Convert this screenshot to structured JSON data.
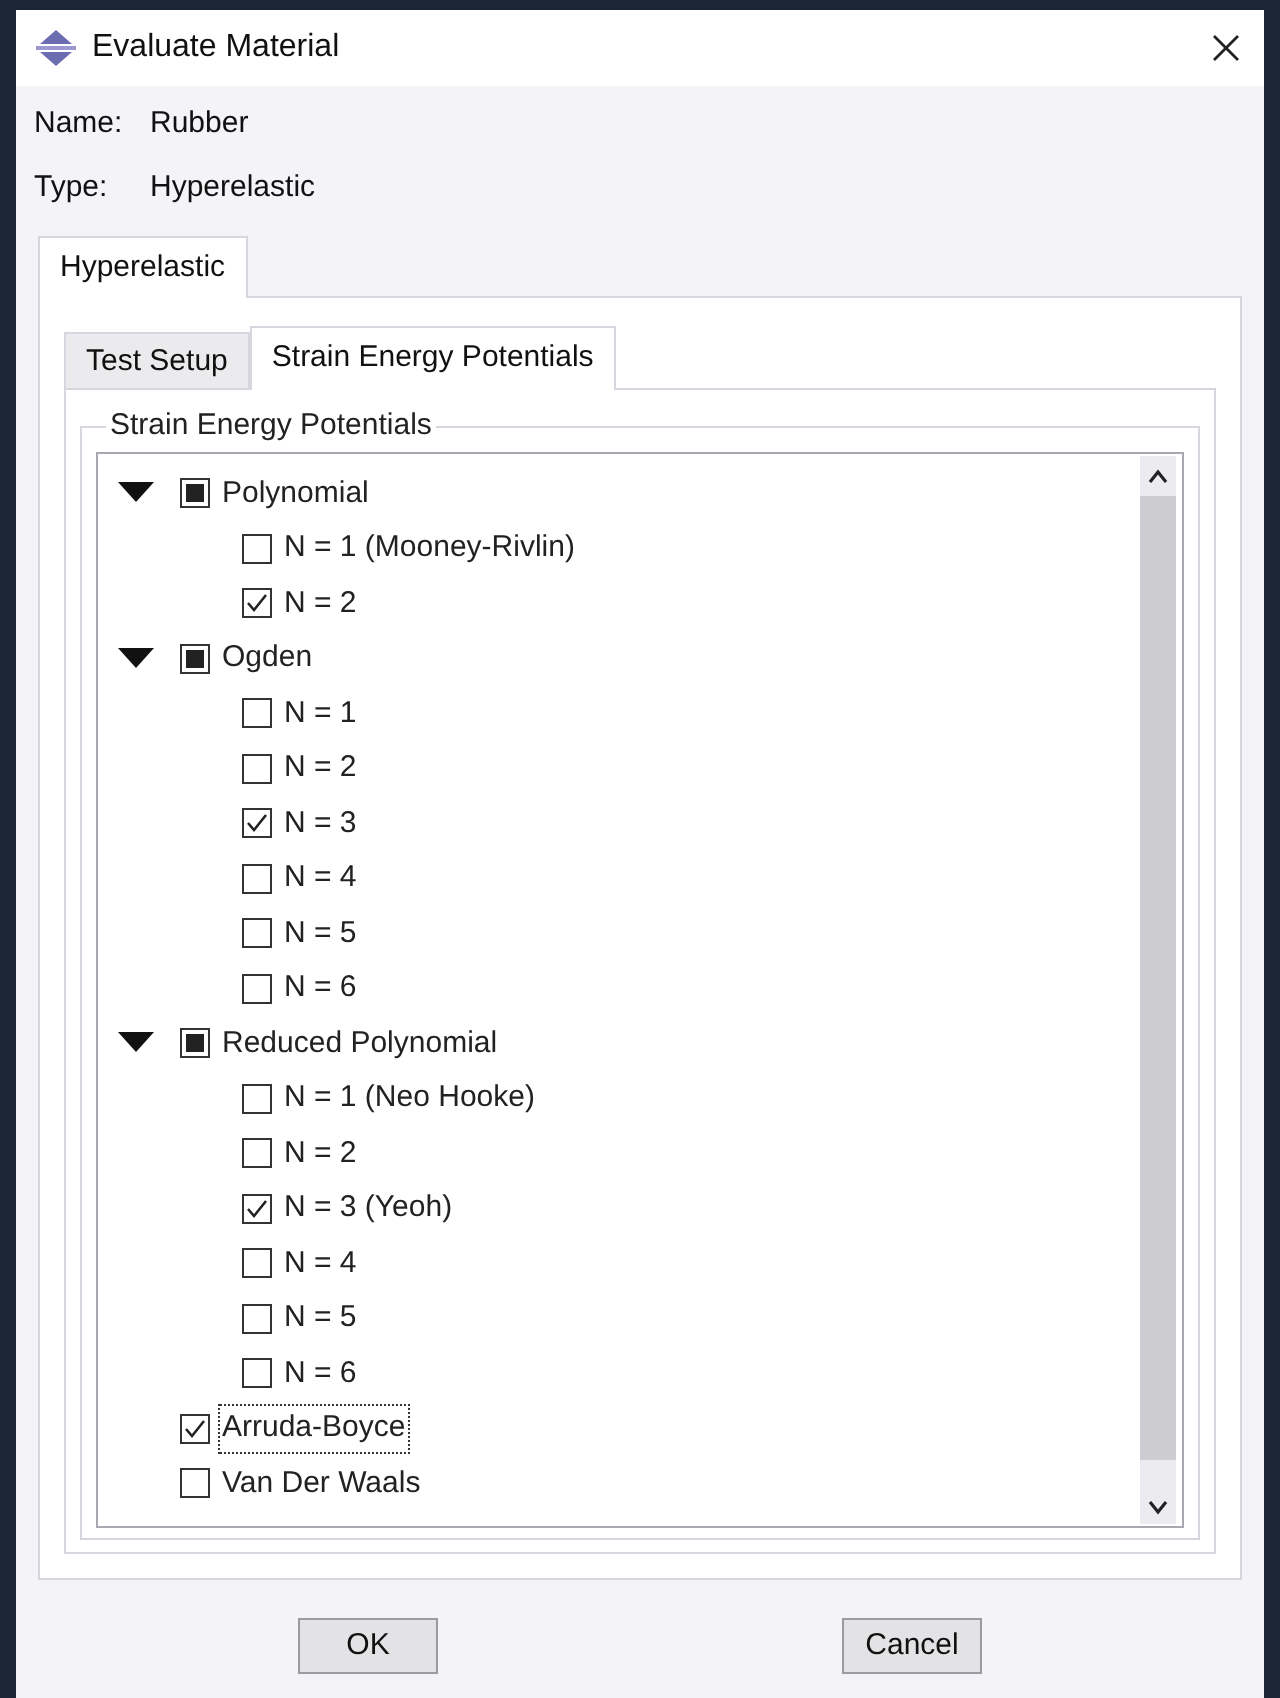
{
  "window": {
    "title": "Evaluate Material"
  },
  "fields": [
    {
      "label": "Name:",
      "value": "Rubber"
    },
    {
      "label": "Type:",
      "value": "Hyperelastic"
    }
  ],
  "outer_tabs": [
    {
      "label": "Hyperelastic",
      "selected": true
    }
  ],
  "inner_tabs": [
    {
      "label": "Test Setup",
      "selected": false
    },
    {
      "label": "Strain Energy Potentials",
      "selected": true
    }
  ],
  "group_title": "Strain Energy Potentials",
  "tree": [
    {
      "label": "Polynomial",
      "expanded": true,
      "checked": false,
      "partial": true,
      "children": [
        {
          "label": "N = 1 (Mooney-Rivlin)",
          "checked": false
        },
        {
          "label": "N = 2",
          "checked": true
        }
      ]
    },
    {
      "label": "Ogden",
      "expanded": true,
      "checked": false,
      "partial": true,
      "children": [
        {
          "label": "N = 1",
          "checked": false
        },
        {
          "label": "N = 2",
          "checked": false
        },
        {
          "label": "N = 3",
          "checked": true
        },
        {
          "label": "N = 4",
          "checked": false
        },
        {
          "label": "N = 5",
          "checked": false
        },
        {
          "label": "N = 6",
          "checked": false
        }
      ]
    },
    {
      "label": "Reduced Polynomial",
      "expanded": true,
      "checked": false,
      "partial": true,
      "children": [
        {
          "label": "N = 1 (Neo Hooke)",
          "checked": false
        },
        {
          "label": "N = 2",
          "checked": false
        },
        {
          "label": "N = 3 (Yeoh)",
          "checked": true
        },
        {
          "label": "N = 4",
          "checked": false
        },
        {
          "label": "N = 5",
          "checked": false
        },
        {
          "label": "N = 6",
          "checked": false
        }
      ]
    },
    {
      "label": "Arruda-Boyce",
      "checked": true,
      "focused": true
    },
    {
      "label": "Van Der Waals",
      "checked": false,
      "focused": false
    }
  ],
  "buttons": [
    "OK",
    "Cancel"
  ]
}
